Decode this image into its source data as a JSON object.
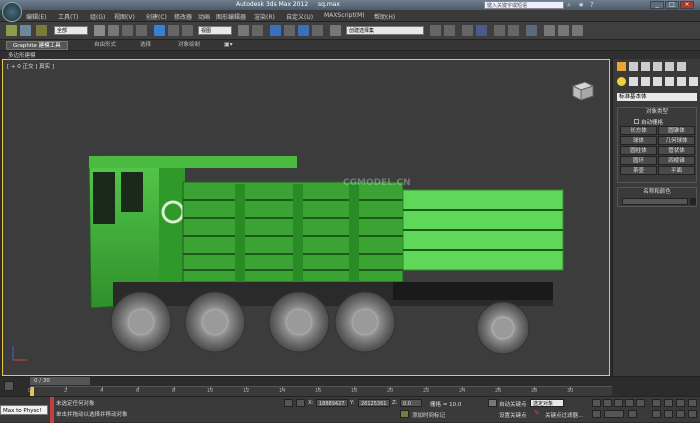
{
  "window": {
    "title": "Autodesk 3ds Max  2012",
    "file": "sq.max",
    "search_placeholder": "键入关键字或短语",
    "controls": [
      "_",
      "□",
      "×"
    ]
  },
  "menu": [
    "编辑(E)",
    "工具(T)",
    "组(G)",
    "视图(V)",
    "创建(C)",
    "修改器",
    "动画",
    "图形编辑器",
    "渲染(R)",
    "自定义(U)",
    "MAXScript(M)",
    "帮助(H)"
  ],
  "toolbar": {
    "selection_filter": "全部",
    "ref_coord": "视图",
    "named_selection": "创建选择集"
  },
  "ribbon": {
    "tabs": [
      "Graphite 建模工具",
      "自由形式",
      "选择",
      "对象绘制"
    ],
    "sub_label": "多边形建模"
  },
  "viewport": {
    "label": "[ + 0 正交 ] 真实 ]",
    "watermark": "CGMODEL.CN"
  },
  "command_panel": {
    "category": "标准基本体",
    "group_title": "对象类型",
    "autogrid": "自动栅格",
    "buttons": [
      "长方体",
      "圆锥体",
      "球体",
      "几何球体",
      "圆柱体",
      "管状体",
      "圆环",
      "四棱锥",
      "茶壶",
      "平面"
    ],
    "name_group": "名称和颜色"
  },
  "timeline": {
    "frame_counter": "0 / 30",
    "ticks": [
      "0",
      "2",
      "4",
      "6",
      "8",
      "10",
      "12",
      "14",
      "16",
      "18",
      "20",
      "22",
      "24",
      "26",
      "28",
      "30"
    ]
  },
  "status": {
    "maxscript": "Max to Physc!",
    "prompt1": "未选定任何对象",
    "prompt2": "单击并拖动以选择并移动对象",
    "x_label": "X:",
    "x_value": "18889427",
    "y_label": "Y:",
    "y_value": "28125361",
    "z_label": "Z:",
    "z_value": "0.0",
    "grid": "栅格 = 10.0",
    "add_time_tag": "添加时间标记",
    "autokey": "自动关键点",
    "set_key": "设置关键点",
    "selected": "选定对象",
    "key_filters": "关键点过滤器..."
  },
  "colors": {
    "truck_green": "#3fae3a",
    "viewport_border": "#e8c64a"
  }
}
